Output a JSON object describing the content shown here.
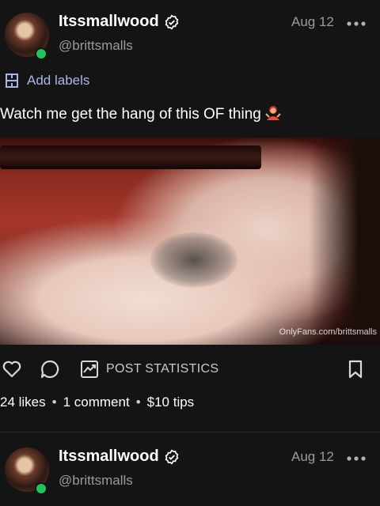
{
  "post1": {
    "display_name": "Itssmallwood",
    "handle": "@brittsmalls",
    "date": "Aug 12",
    "add_labels": "Add labels",
    "caption": "Watch me get the hang of this OF thing",
    "watermark": "OnlyFans.com/brittsmalls",
    "post_statistics": "POST STATISTICS",
    "likes": "24 likes",
    "comments": "1 comment",
    "tips": "$10 tips"
  },
  "post2": {
    "display_name": "Itssmallwood",
    "handle": "@brittsmalls",
    "date": "Aug 12"
  },
  "icons": [
    "verified-icon",
    "more-icon",
    "labels-icon",
    "like-icon",
    "comment-icon",
    "stats-icon",
    "bookmark-icon"
  ],
  "colors": {
    "accent_label": "#a8b8e8",
    "online": "#21c45a",
    "background": "#141414"
  }
}
